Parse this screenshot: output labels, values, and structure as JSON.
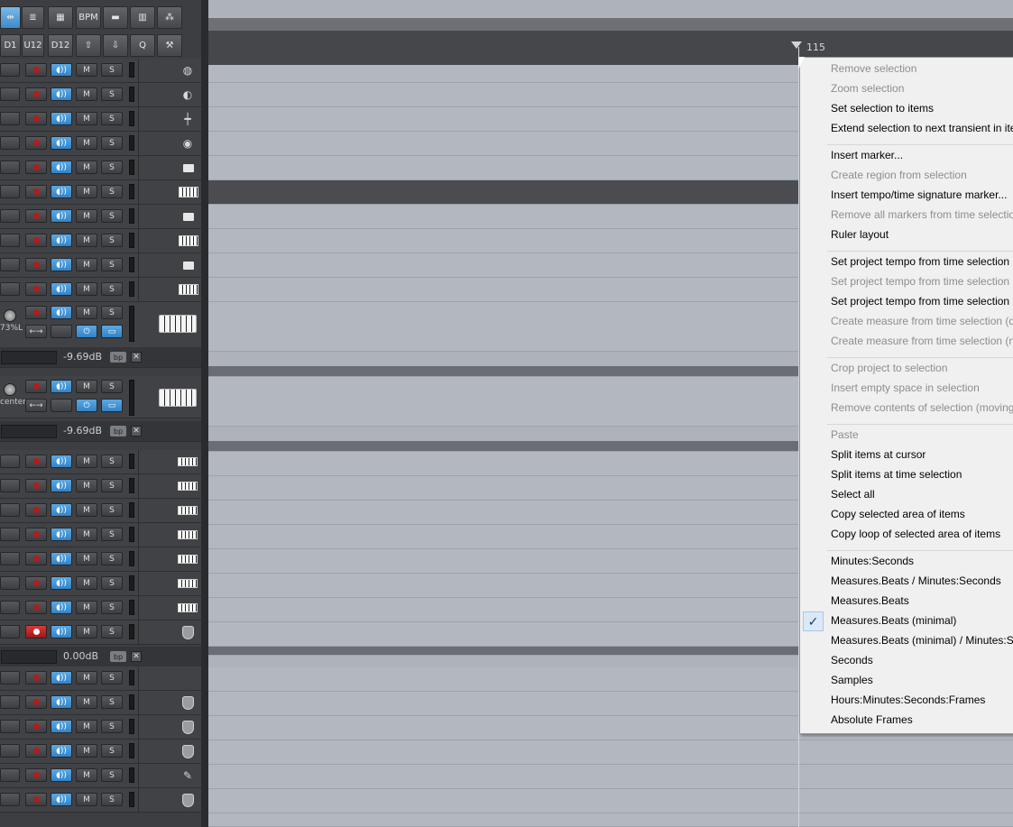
{
  "toolbar": {
    "row1": [
      {
        "name": "split-mode-button",
        "label": "",
        "icon": "split-icon",
        "active": true
      },
      {
        "name": "list-view-button",
        "label": "",
        "icon": "list-icon"
      },
      {
        "name": "colors-button",
        "label": "",
        "icon": "colors-icon"
      },
      {
        "name": "bpm-button",
        "label": "BPM"
      },
      {
        "name": "folder-button",
        "label": "",
        "icon": "folder-icon"
      },
      {
        "name": "grid-button",
        "label": "",
        "icon": "grid-icon"
      },
      {
        "name": "snap-button",
        "label": "",
        "icon": "snap-icon"
      }
    ],
    "row2": [
      {
        "name": "d1-button",
        "label": "D1"
      },
      {
        "name": "u12-button",
        "label": "U12"
      },
      {
        "name": "d12-button",
        "label": "D12"
      },
      {
        "name": "move-up-button",
        "label": "",
        "icon": "move-up-icon"
      },
      {
        "name": "move-down-button",
        "label": "",
        "icon": "move-down-icon"
      },
      {
        "name": "quantize-button",
        "label": "Q"
      },
      {
        "name": "tools-button",
        "label": "",
        "icon": "wrench-icon"
      }
    ]
  },
  "track_buttons": {
    "mute": "M",
    "solo": "S"
  },
  "tracks": {
    "group1": [
      "drums-icon",
      "cymbal-icon",
      "hihat-icon",
      "drumkit-icon",
      "folder-icon",
      "keyboard-icon",
      "folder-icon",
      "keyboard-icon",
      "folder-icon",
      "keyboard-icon"
    ],
    "inst1": {
      "pan_label": "73%L",
      "db": "-9.69dB",
      "fx_label": "bp",
      "close_label": "✕"
    },
    "inst2": {
      "pan_label": "center",
      "db": "-9.69dB",
      "fx_label": "bp",
      "close_label": "✕"
    },
    "group2": [
      "synth-icon",
      "synth-icon",
      "synth-icon",
      "synth-icon",
      "synth-icon",
      "synth-icon",
      "synth-icon"
    ],
    "armed": {
      "db": "0.00dB",
      "fx_label": "bp",
      "close_label": "✕"
    },
    "group3": [
      "",
      "shield-icon",
      "shield-icon",
      "shield-icon",
      "mic-icon",
      "shield-icon"
    ]
  },
  "ruler": {
    "marker": "115"
  },
  "context_menu": {
    "sections": [
      [
        {
          "label": "Remove selection",
          "disabled": true
        },
        {
          "label": "Zoom selection",
          "disabled": true
        },
        {
          "label": "Set selection to items",
          "disabled": false
        },
        {
          "label": "Extend selection to next transient in ite",
          "disabled": false
        }
      ],
      [
        {
          "label": "Insert marker...",
          "disabled": false
        },
        {
          "label": "Create region from selection",
          "disabled": true
        },
        {
          "label": "Insert tempo/time signature marker...",
          "disabled": false
        },
        {
          "label": "Remove all markers from time selectio",
          "disabled": true
        },
        {
          "label": "Ruler layout",
          "disabled": false
        }
      ],
      [
        {
          "label": "Set project tempo from time selection",
          "disabled": false
        },
        {
          "label": "Set project tempo from time selection",
          "disabled": true
        },
        {
          "label": "Set project tempo from time selection",
          "disabled": false
        },
        {
          "label": "Create measure from time selection (d",
          "disabled": true
        },
        {
          "label": "Create measure from time selection (n",
          "disabled": true
        }
      ],
      [
        {
          "label": "Crop project to selection",
          "disabled": true
        },
        {
          "label": "Insert empty space in selection",
          "disabled": true
        },
        {
          "label": "Remove contents of selection (moving",
          "disabled": true
        }
      ],
      [
        {
          "label": "Paste",
          "disabled": true
        },
        {
          "label": "Split items at cursor",
          "disabled": false
        },
        {
          "label": "Split items at time selection",
          "disabled": false
        },
        {
          "label": "Select all",
          "disabled": false
        },
        {
          "label": "Copy selected area of items",
          "disabled": false
        },
        {
          "label": "Copy loop of selected area of items",
          "disabled": false
        }
      ],
      [
        {
          "label": "Minutes:Seconds",
          "disabled": false
        },
        {
          "label": "Measures.Beats / Minutes:Seconds",
          "disabled": false
        },
        {
          "label": "Measures.Beats",
          "disabled": false
        },
        {
          "label": "Measures.Beats (minimal)",
          "disabled": false,
          "checked": true
        },
        {
          "label": "Measures.Beats (minimal) / Minutes:Se",
          "disabled": false
        },
        {
          "label": "Seconds",
          "disabled": false
        },
        {
          "label": "Samples",
          "disabled": false
        },
        {
          "label": "Hours:Minutes:Seconds:Frames",
          "disabled": false
        },
        {
          "label": "Absolute Frames",
          "disabled": false
        }
      ]
    ],
    "check_mark": "✓"
  }
}
